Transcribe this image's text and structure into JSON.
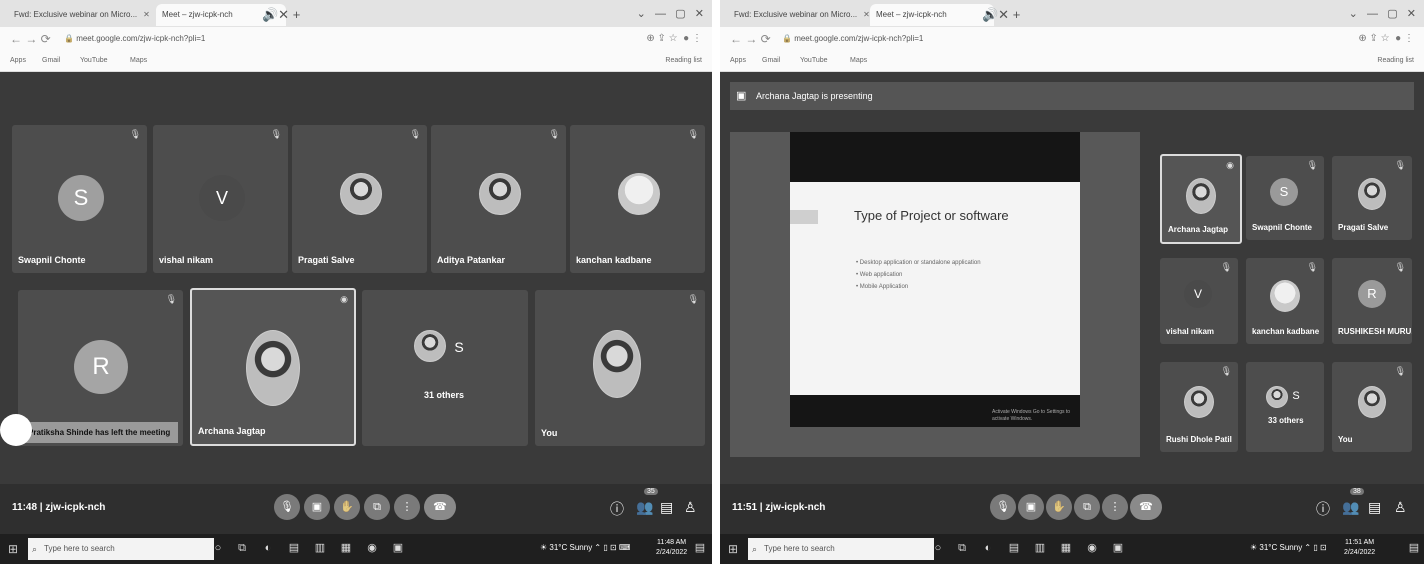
{
  "left": {
    "browser": {
      "tabs": [
        {
          "label": "Fwd: Exclusive webinar on Micro..."
        },
        {
          "label": "Meet – zjw-icpk-nch"
        }
      ],
      "url": "meet.google.com/zjw-icpk-nch?pli=1",
      "bookmarks": [
        "Apps",
        "Gmail",
        "YouTube",
        "Maps"
      ],
      "reading_list": "Reading list"
    },
    "tiles_row1": [
      {
        "name": "Swapnil Chonte",
        "initial": "S"
      },
      {
        "name": "vishal nikam",
        "initial": "V"
      },
      {
        "name": "Pragati Salve"
      },
      {
        "name": "Aditya Patankar"
      },
      {
        "name": "kanchan kadbane"
      }
    ],
    "tiles_row2": [
      {
        "name": "",
        "initial": "R"
      },
      {
        "name": "Archana Jagtap"
      },
      {
        "name": "31 others",
        "initial": "S"
      },
      {
        "name": "You"
      }
    ],
    "toast": "Pratiksha Shinde has left the meeting",
    "meeting_time": "11:48",
    "meeting_code": "zjw-icpk-nch",
    "participants_badge": "35",
    "taskbar": {
      "search_placeholder": "Type here to search",
      "weather": "31°C Sunny",
      "time": "11:48 AM",
      "date": "2/24/2022"
    }
  },
  "right": {
    "browser": {
      "tabs": [
        {
          "label": "Fwd: Exclusive webinar on Micro..."
        },
        {
          "label": "Meet – zjw-icpk-nch"
        }
      ],
      "url": "meet.google.com/zjw-icpk-nch?pli=1",
      "bookmarks": [
        "Apps",
        "Gmail",
        "YouTube",
        "Maps"
      ],
      "reading_list": "Reading list"
    },
    "presenting_banner": "Archana Jagtap is presenting",
    "slide": {
      "title": "Type of Project or software",
      "bullets": [
        "Desktop application or standalone application",
        "Web application",
        "Mobile Application"
      ],
      "activate_windows": "Activate Windows Go to Settings to activate Windows."
    },
    "side_tiles": [
      {
        "name": "Archana Jagtap"
      },
      {
        "name": "Swapnil Chonte",
        "initial": "S"
      },
      {
        "name": "Pragati Salve"
      },
      {
        "name": "vishal nikam",
        "initial": "V"
      },
      {
        "name": "kanchan kadbane"
      },
      {
        "name": "RUSHIKESH MURU...",
        "initial": "R"
      },
      {
        "name": "Rushi Dhole Patil"
      },
      {
        "name": "33 others",
        "initial": "S"
      },
      {
        "name": "You"
      }
    ],
    "meeting_time": "11:51",
    "meeting_code": "zjw-icpk-nch",
    "participants_badge": "38",
    "taskbar": {
      "search_placeholder": "Type here to search",
      "weather": "31°C Sunny",
      "time": "11:51 AM",
      "date": "2/24/2022"
    }
  }
}
